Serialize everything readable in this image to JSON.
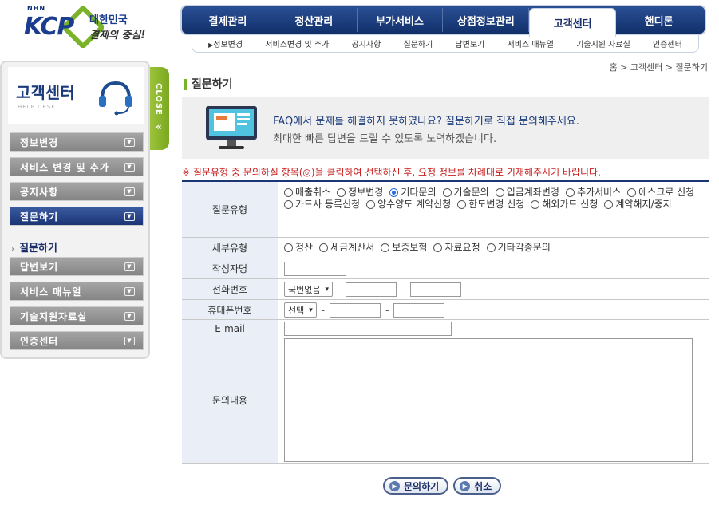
{
  "logo": {
    "brand_top": "NHN",
    "brand": "KCP",
    "slogan1": "대한민국",
    "slogan2": "결제의 중심!"
  },
  "topnav": [
    "결제관리",
    "정산관리",
    "부가서비스",
    "상점정보관리",
    "고객센터",
    "핸디론"
  ],
  "subnav": [
    "정보변경",
    "서비스변경 및 추가",
    "공지사항",
    "질문하기",
    "답변보기",
    "서비스 매뉴얼",
    "기술지원 자료실",
    "인증센터"
  ],
  "breadcrumb": "홈 > 고객센터 > 질문하기",
  "side": {
    "title": "고객센터",
    "subtitle": "HELP DESK",
    "close": "CLOSE",
    "menu": [
      "정보변경",
      "서비스 변경 및 추가",
      "공지사항",
      "질문하기",
      "답변보기",
      "서비스 매뉴얼",
      "기술지원자료실",
      "인증센터"
    ],
    "submenu": "질문하기"
  },
  "page_title": "질문하기",
  "banner": {
    "line1": "FAQ에서 문제를 해결하지 못하였나요? 질문하기로 직접 문의해주세요.",
    "line2": "최대한 빠른 답변을 드릴 수 있도록 노력하겠습니다."
  },
  "notice": "※ 질문유형 중 문의하실 항목(◎)을 클릭하여 선택하신 후, 요청 정보를 차례대로 기재해주시기 바랍니다.",
  "form": {
    "type_label": "질문유형",
    "types": [
      "매출취소",
      "정보변경",
      "기타문의",
      "기술문의",
      "입금계좌변경",
      "추가서비스",
      "에스크로 신청",
      "카드사 등록신청",
      "양수양도 계약신청",
      "한도변경 신청",
      "해외카드 신청",
      "계약해지/중지"
    ],
    "type_selected": "기타문의",
    "subtype_label": "세부유형",
    "subtypes": [
      "정산",
      "세금계산서",
      "보증보험",
      "자료요청",
      "기타각종문의"
    ],
    "author_label": "작성자명",
    "phone_label": "전화번호",
    "phone_select": "국번없음",
    "mobile_label": "휴대폰번호",
    "mobile_select": "선택",
    "email_label": "E-mail",
    "content_label": "문의내용"
  },
  "buttons": {
    "submit": "문의하기",
    "cancel": "취소"
  }
}
